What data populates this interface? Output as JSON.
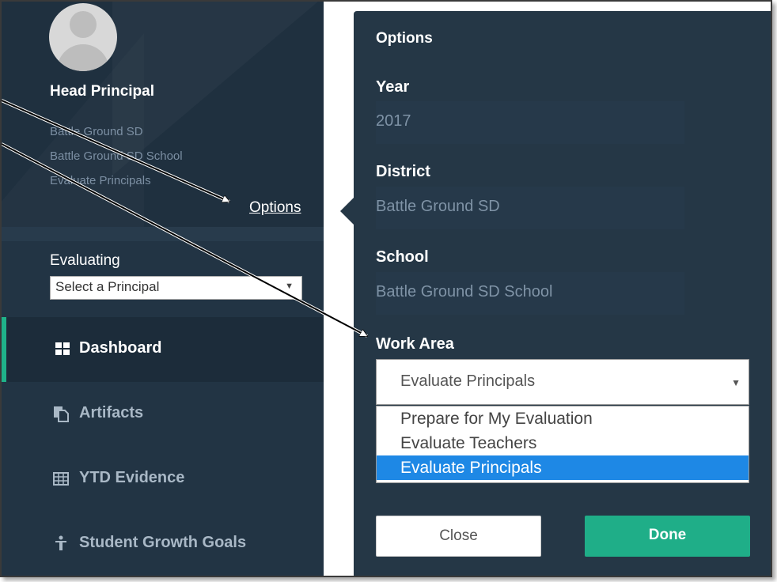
{
  "sidebar": {
    "user_name": "Head Principal",
    "district": "Battle Ground SD",
    "school": "Battle Ground SD School",
    "work_area": "Evaluate Principals",
    "options_link": "Options",
    "evaluating_label": "Evaluating",
    "principal_select_value": "Select a Principal",
    "nav": [
      {
        "label": "Dashboard",
        "icon": "dashboard-grid-icon",
        "active": true
      },
      {
        "label": "Artifacts",
        "icon": "artifacts-icon",
        "active": false
      },
      {
        "label": "YTD Evidence",
        "icon": "table-icon",
        "active": false
      },
      {
        "label": "Student Growth Goals",
        "icon": "person-icon",
        "active": false
      }
    ]
  },
  "options_panel": {
    "title": "Options",
    "year_label": "Year",
    "year_value": "2017",
    "district_label": "District",
    "district_value": "Battle Ground SD",
    "school_label": "School",
    "school_value": "Battle Ground SD School",
    "work_area_label": "Work Area",
    "work_area_selected": "Evaluate Principals",
    "work_area_options": [
      "Prepare for My Evaluation",
      "Evaluate Teachers",
      "Evaluate Principals"
    ],
    "close_label": "Close",
    "done_label": "Done"
  },
  "colors": {
    "sidebar_bg": "#223444",
    "panel_bg": "#253746",
    "accent_green": "#1fae88",
    "selected_blue": "#1e88e5"
  }
}
